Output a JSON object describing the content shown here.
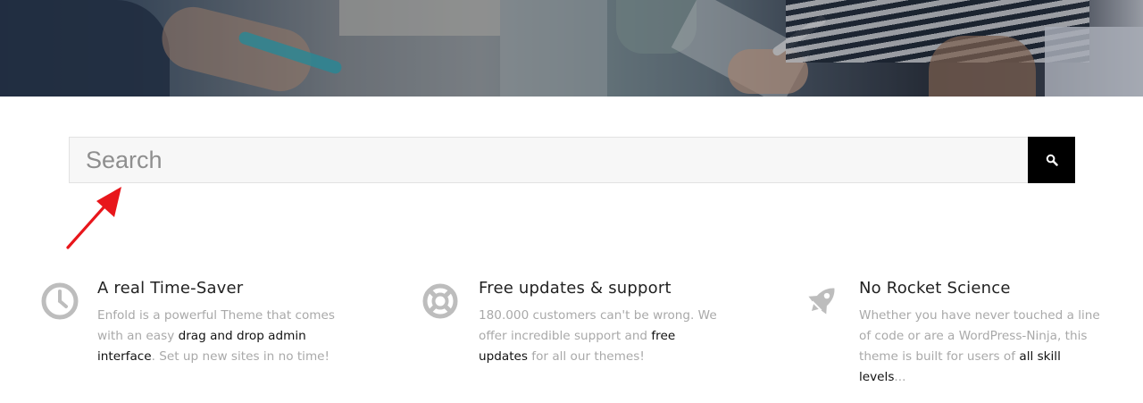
{
  "search": {
    "placeholder": "Search"
  },
  "features": [
    {
      "icon": "clock-icon",
      "title": "A real Time-Saver",
      "text_before": "Enfold is a powerful Theme that comes with an easy ",
      "link": "drag and drop admin interface",
      "text_after": ". Set up new sites in no time!"
    },
    {
      "icon": "lifebuoy-icon",
      "title": "Free updates & support",
      "text_before": "180.000 customers can't be wrong. We offer incredible support and ",
      "link": "free updates",
      "text_after": " for all our themes!"
    },
    {
      "icon": "rocket-icon",
      "title": "No Rocket Science",
      "text_before": "Whether you have never touched a line of code or are a WordPress-Ninja, this theme is built for users of ",
      "link": "all skill levels",
      "text_after": "..."
    }
  ],
  "colors": {
    "search_button": "#000000",
    "icon_gray": "#bdbdbd",
    "annotation_arrow": "#e8161b"
  }
}
